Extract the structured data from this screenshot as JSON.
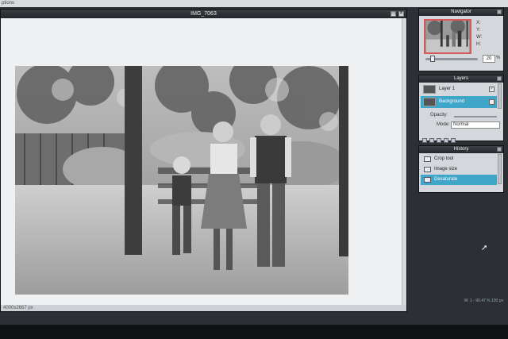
{
  "app": {
    "menu_fragment": "ptions"
  },
  "document": {
    "title": "IMG_7063",
    "status_dims": "4000x2667 px",
    "controls": {
      "restore": "▭",
      "close": "✕"
    }
  },
  "navigator": {
    "title": "Navigator",
    "zoom_value": "20",
    "zoom_unit": "%",
    "x_label": "X:",
    "y_label": "Y:",
    "w_label": "W:",
    "h_label": "H:"
  },
  "layers": {
    "title": "Layers",
    "items": [
      {
        "name": "Layer 1",
        "active": false,
        "visible_glyph": "✓"
      },
      {
        "name": "Background",
        "active": true,
        "visible_glyph": "✓"
      }
    ],
    "opacity_label": "Opacity:",
    "mode_label": "Mode:",
    "mode_value": "Normal"
  },
  "history": {
    "title": "History",
    "items": [
      {
        "name": "Crop tool",
        "active": false
      },
      {
        "name": "Image size",
        "active": false
      },
      {
        "name": "Desaturate",
        "active": true
      }
    ]
  },
  "readout": {
    "text": "W: 1 - 90.47 % 100 px"
  },
  "colors": {
    "accent": "#3fa6c9",
    "panel": "#d4d8dc",
    "workspace": "#2c2f33",
    "nav_frame": "#d85a5a"
  }
}
